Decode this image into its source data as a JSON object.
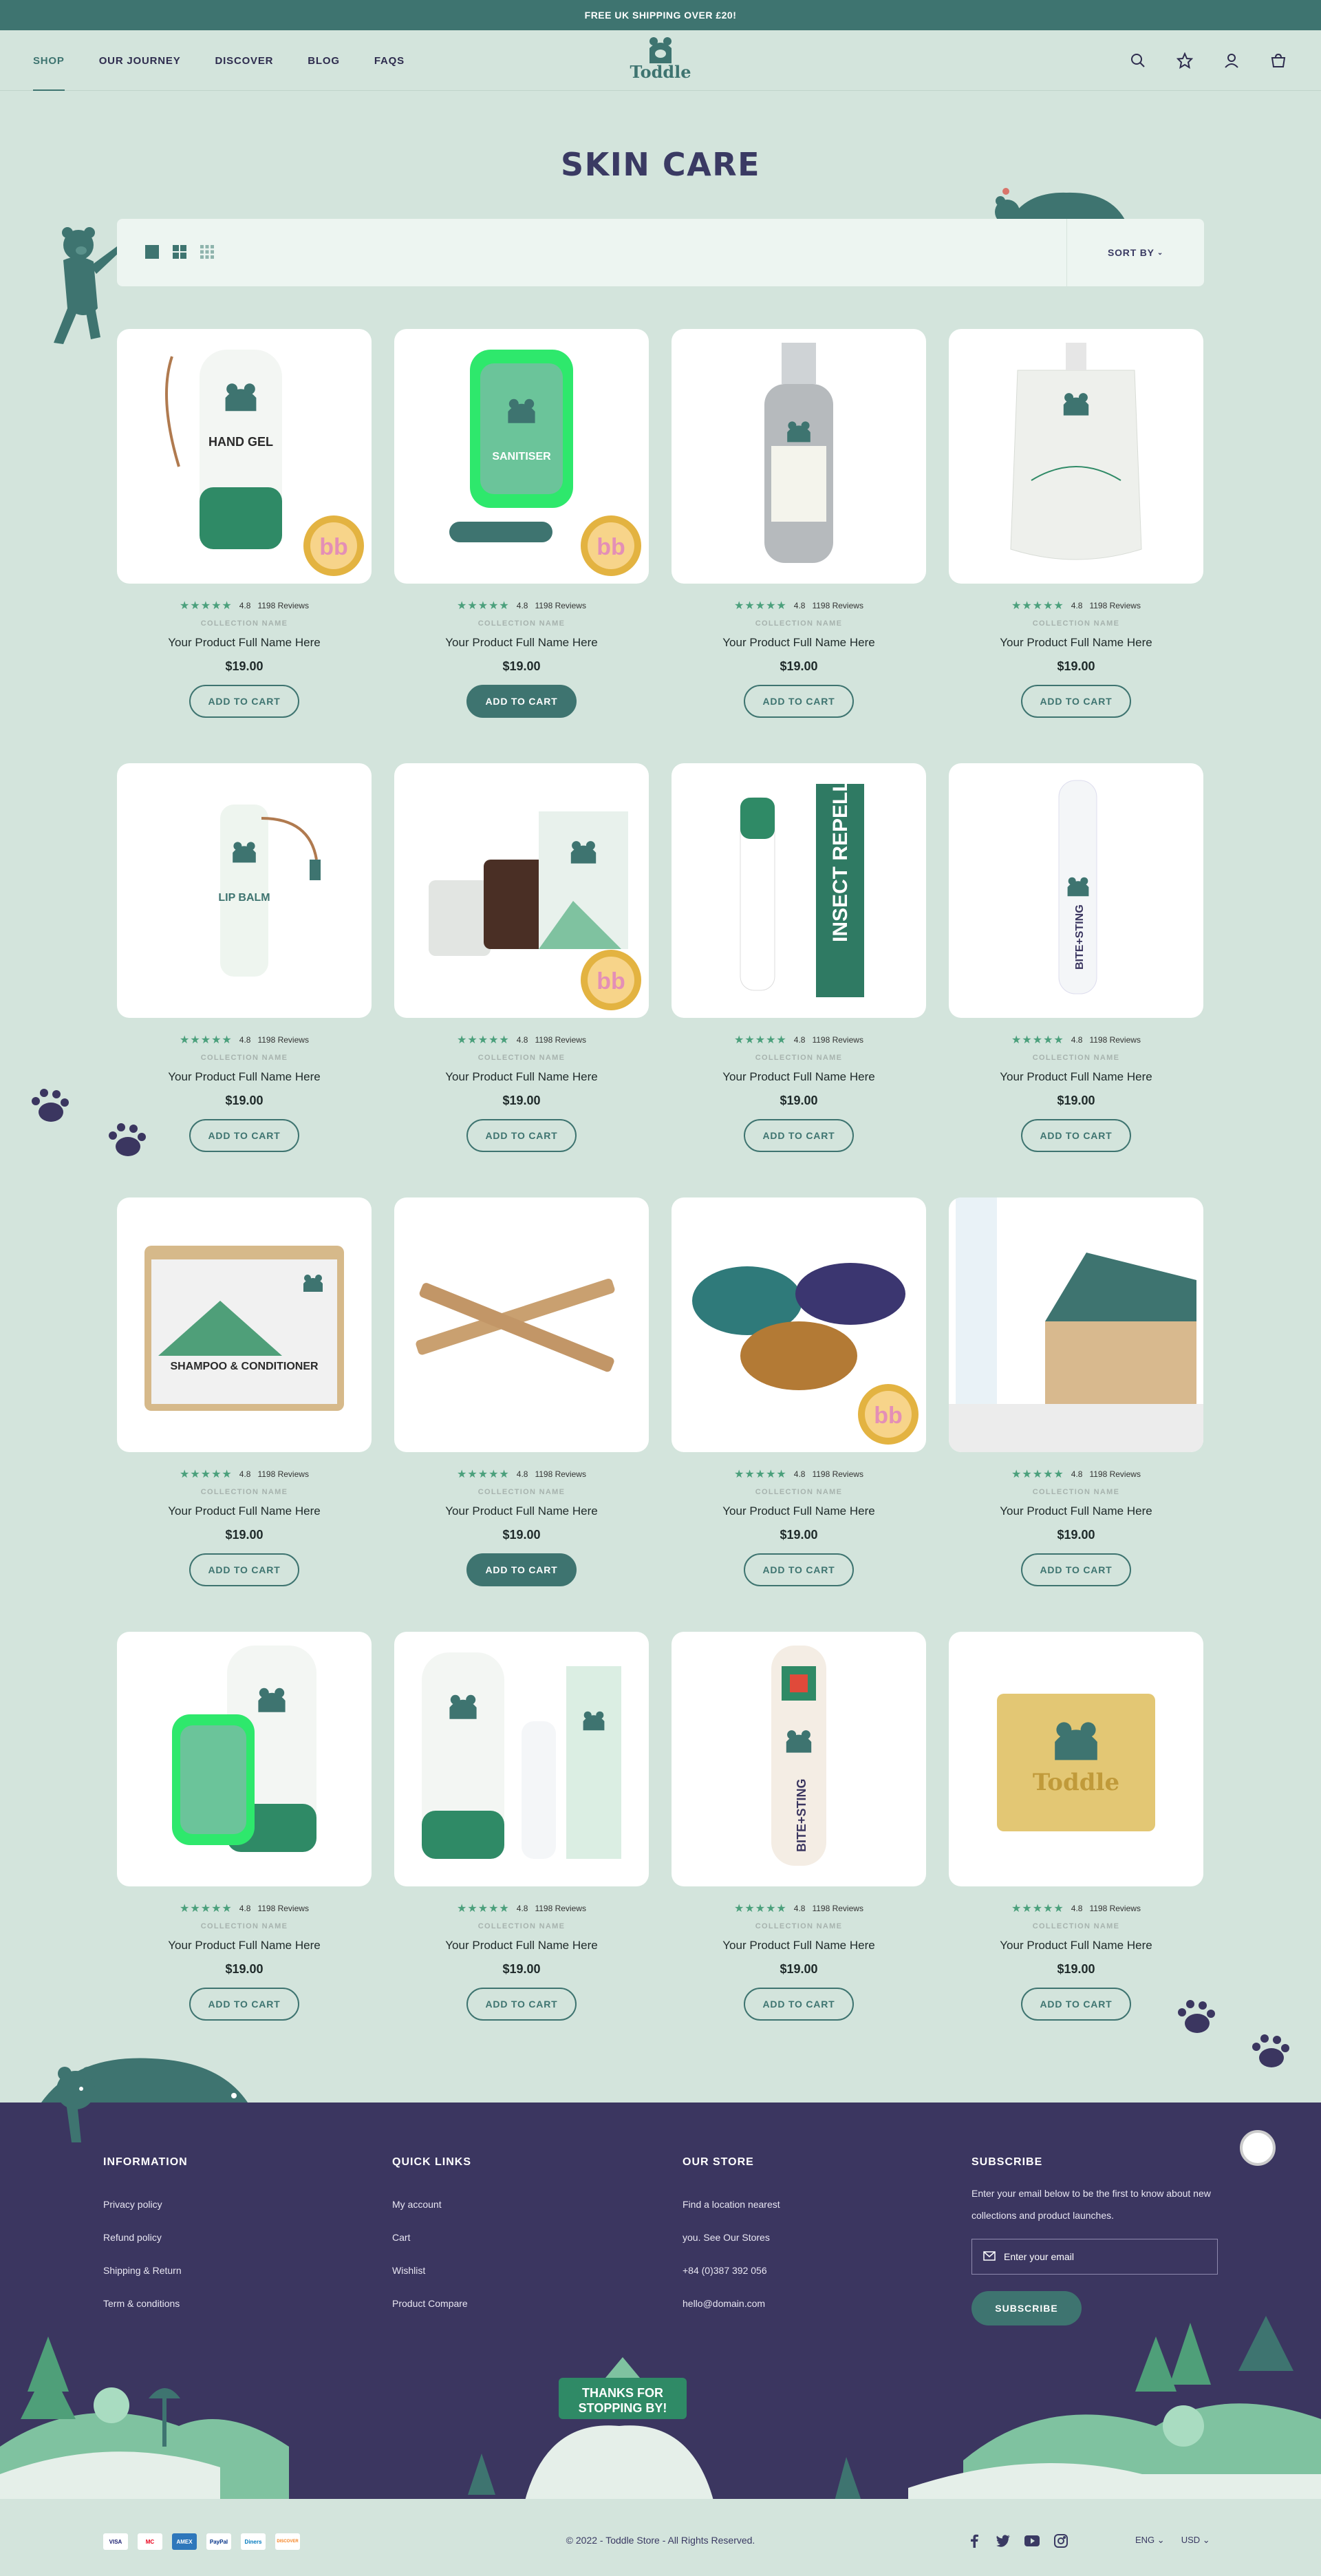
{
  "announcement": "FREE UK SHIPPING OVER £20!",
  "nav": [
    {
      "label": "SHOP",
      "active": true
    },
    {
      "label": "OUR JOURNEY"
    },
    {
      "label": "DISCOVER"
    },
    {
      "label": "BLOG"
    },
    {
      "label": "FAQS"
    }
  ],
  "logo": "Toddle",
  "header_icons": [
    "search-icon",
    "star-icon",
    "user-icon",
    "bag-icon"
  ],
  "page_title": "SKIN CARE",
  "toolbar": {
    "views": [
      "list-view-icon",
      "grid-2-icon",
      "grid-3-icon"
    ],
    "sort_label": "SORT BY"
  },
  "products": [
    {
      "rating": "4.8",
      "reviews": "1198 Reviews",
      "collection": "COLLECTION NAME",
      "name": "Your Product Full Name Here",
      "price": "$19.00",
      "cta": "ADD TO CART",
      "image": "probiotic-hand-gel",
      "badge": true
    },
    {
      "rating": "4.8",
      "reviews": "1198 Reviews",
      "collection": "COLLECTION NAME",
      "name": "Your Product Full Name Here",
      "price": "$19.00",
      "cta": "ADD TO CART",
      "image": "hand-sanitiser",
      "badge": true,
      "filled": true
    },
    {
      "rating": "4.8",
      "reviews": "1198 Reviews",
      "collection": "COLLECTION NAME",
      "name": "Your Product Full Name Here",
      "price": "$19.00",
      "cta": "ADD TO CART",
      "image": "sun-spray"
    },
    {
      "rating": "4.8",
      "reviews": "1198 Reviews",
      "collection": "COLLECTION NAME",
      "name": "Your Product Full Name Here",
      "price": "$19.00",
      "cta": "ADD TO CART",
      "image": "sanitiser-refill"
    },
    {
      "rating": "4.8",
      "reviews": "1198 Reviews",
      "collection": "COLLECTION NAME",
      "name": "Your Product Full Name Here",
      "price": "$19.00",
      "cta": "ADD TO CART",
      "image": "lip-balm"
    },
    {
      "rating": "4.8",
      "reviews": "1198 Reviews",
      "collection": "COLLECTION NAME",
      "name": "Your Product Full Name Here",
      "price": "$19.00",
      "cta": "ADD TO CART",
      "image": "adventure-balm",
      "badge": true
    },
    {
      "rating": "4.8",
      "reviews": "1198 Reviews",
      "collection": "COLLECTION NAME",
      "name": "Your Product Full Name Here",
      "price": "$19.00",
      "cta": "ADD TO CART",
      "image": "insect-repellent"
    },
    {
      "rating": "4.8",
      "reviews": "1198 Reviews",
      "collection": "COLLECTION NAME",
      "name": "Your Product Full Name Here",
      "price": "$19.00",
      "cta": "ADD TO CART",
      "image": "bite-sting-relief"
    },
    {
      "rating": "4.8",
      "reviews": "1198 Reviews",
      "collection": "COLLECTION NAME",
      "name": "Your Product Full Name Here",
      "price": "$19.00",
      "cta": "ADD TO CART",
      "image": "shampoo-bar"
    },
    {
      "rating": "4.8",
      "reviews": "1198 Reviews",
      "collection": "COLLECTION NAME",
      "name": "Your Product Full Name Here",
      "price": "$19.00",
      "cta": "ADD TO CART",
      "image": "wooden-sticks",
      "filled": true
    },
    {
      "rating": "4.8",
      "reviews": "1198 Reviews",
      "collection": "COLLECTION NAME",
      "name": "Your Product Full Name Here",
      "price": "$19.00",
      "cta": "ADD TO CART",
      "image": "snoods",
      "badge": true
    },
    {
      "rating": "4.8",
      "reviews": "1198 Reviews",
      "collection": "COLLECTION NAME",
      "name": "Your Product Full Name Here",
      "price": "$19.00",
      "cta": "ADD TO CART",
      "image": "adventure-box"
    },
    {
      "rating": "4.8",
      "reviews": "1198 Reviews",
      "collection": "COLLECTION NAME",
      "name": "Your Product Full Name Here",
      "price": "$19.00",
      "cta": "ADD TO CART",
      "image": "gel-sanitiser-bundle"
    },
    {
      "rating": "4.8",
      "reviews": "1198 Reviews",
      "collection": "COLLECTION NAME",
      "name": "Your Product Full Name Here",
      "price": "$19.00",
      "cta": "ADD TO CART",
      "image": "gel-balm-bundle"
    },
    {
      "rating": "4.8",
      "reviews": "1198 Reviews",
      "collection": "COLLECTION NAME",
      "name": "Your Product Full Name Here",
      "price": "$19.00",
      "cta": "ADD TO CART",
      "image": "bite-sting-stick"
    },
    {
      "rating": "4.8",
      "reviews": "1198 Reviews",
      "collection": "COLLECTION NAME",
      "name": "Your Product Full Name Here",
      "price": "$19.00",
      "cta": "ADD TO CART",
      "image": "soap-bar"
    }
  ],
  "footer": {
    "information": {
      "title": "INFORMATION",
      "links": [
        "Privacy policy",
        "Refund policy",
        "Shipping & Return",
        "Term & conditions"
      ]
    },
    "quick_links": {
      "title": "QUICK LINKS",
      "links": [
        "My account",
        "Cart",
        "Wishlist",
        "Product Compare"
      ]
    },
    "our_store": {
      "title": "OUR STORE",
      "lines": [
        "Find a location nearest",
        "you. See Our Stores",
        "+84 (0)387 392 056",
        "hello@domain.com"
      ]
    },
    "subscribe": {
      "title": "SUBSCRIBE",
      "text": "Enter your email below to be the first to know about new collections and product launches.",
      "placeholder": "Enter your email",
      "button": "SUBSCRIBE"
    },
    "sign_line1": "THANKS FOR",
    "sign_line2": "STOPPING BY!",
    "payments": [
      "VISA",
      "MC",
      "AMEX",
      "PayPal",
      "Diners",
      "DISCOVER"
    ],
    "copyright": "© 2022 - Toddle Store - All Rights Reserved.",
    "socials": [
      "facebook-icon",
      "twitter-icon",
      "youtube-icon",
      "instagram-icon"
    ],
    "language": "ENG",
    "currency": "USD"
  },
  "colors": {
    "teal": "#3e7470",
    "mint_bg": "#d3e4dc",
    "navy": "#3b3660",
    "star": "#4ba07c"
  }
}
